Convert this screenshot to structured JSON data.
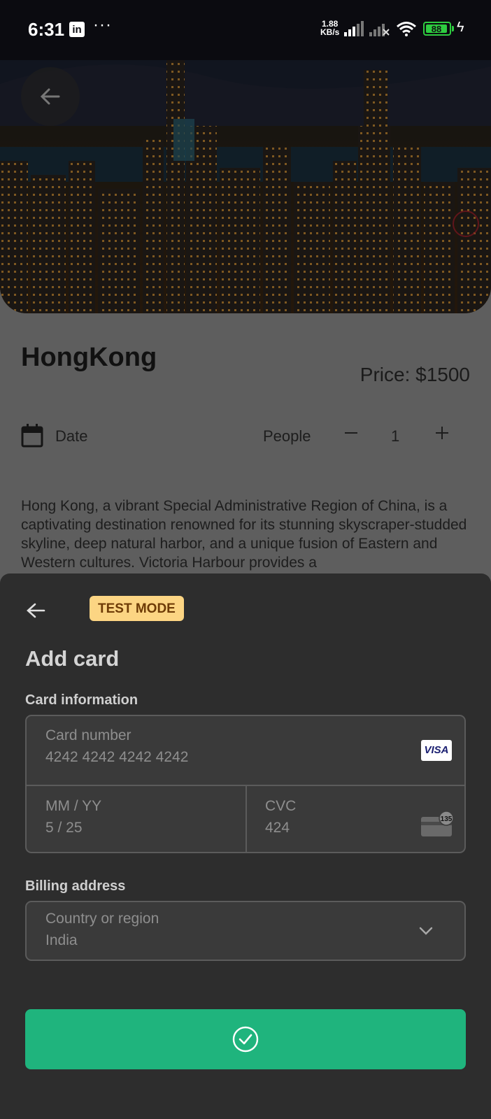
{
  "status_bar": {
    "time": "6:31",
    "app_icon": "in",
    "more": "···",
    "speed_value": "1.88",
    "speed_unit": "KB/s",
    "battery": "88"
  },
  "trip": {
    "title": "HongKong",
    "price": "Price: $1500",
    "date_label": "Date",
    "people_label": "People",
    "quantity": "1",
    "description": "Hong Kong, a vibrant Special Administrative Region of China, is a captivating destination renowned for its stunning skyscraper-studded skyline, deep natural harbor, and a unique fusion of Eastern and Western cultures. Victoria Harbour provides a"
  },
  "sheet": {
    "badge": "TEST MODE",
    "title": "Add card",
    "card_section_label": "Card information",
    "card_number": {
      "label": "Card number",
      "value": "4242 4242 4242 4242"
    },
    "card_brand": "VISA",
    "expiry": {
      "label": "MM / YY",
      "value": "5 / 25"
    },
    "cvc": {
      "label": "CVC",
      "value": "424",
      "hint_icon_number": "135"
    },
    "billing_section_label": "Billing address",
    "country": {
      "label": "Country or region",
      "value": "India"
    }
  },
  "colors": {
    "sheet_background": "#2d2d2d",
    "badge_background": "#fcd583",
    "badge_text": "#6e3b06",
    "pay_button": "#1fb47d",
    "field_background": "#3a3a3a"
  },
  "icons": {
    "back": "arrow-left-icon",
    "calendar": "calendar-icon",
    "minus": "minus-icon",
    "plus": "plus-icon",
    "card_brand": "visa-icon",
    "cvc_hint": "card-back-icon",
    "dropdown": "chevron-down-icon",
    "confirm": "check-circle-icon"
  }
}
